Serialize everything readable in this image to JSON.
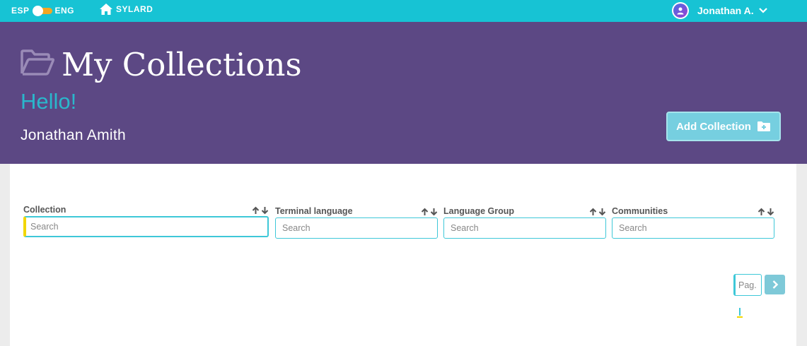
{
  "topbar": {
    "lang_left": "ESP",
    "lang_right": "ENG",
    "home_label": "SYLARD",
    "user_name": "Jonathan A."
  },
  "header": {
    "title": "My Collections",
    "greeting": "Hello!",
    "full_name": "Jonathan Amith",
    "add_button": "Add Collection"
  },
  "table": {
    "columns": [
      {
        "label": "Collection",
        "placeholder": "Search"
      },
      {
        "label": "Terminal language",
        "placeholder": "Search"
      },
      {
        "label": "Language Group",
        "placeholder": "Search"
      },
      {
        "label": "Communities",
        "placeholder": "Search"
      }
    ]
  },
  "pagination": {
    "page_placeholder": "Pag."
  },
  "colors": {
    "topbar": "#17c3d4",
    "header": "#5c4884",
    "accent": "#2ab7cc",
    "toggle": "#f5a623",
    "focus": "#f2d600"
  },
  "icons": [
    "home-icon",
    "folder-open-icon",
    "folder-plus-icon",
    "avatar-icon",
    "chevron-down-icon",
    "arrow-up-icon",
    "arrow-down-icon",
    "chevron-right-icon"
  ]
}
